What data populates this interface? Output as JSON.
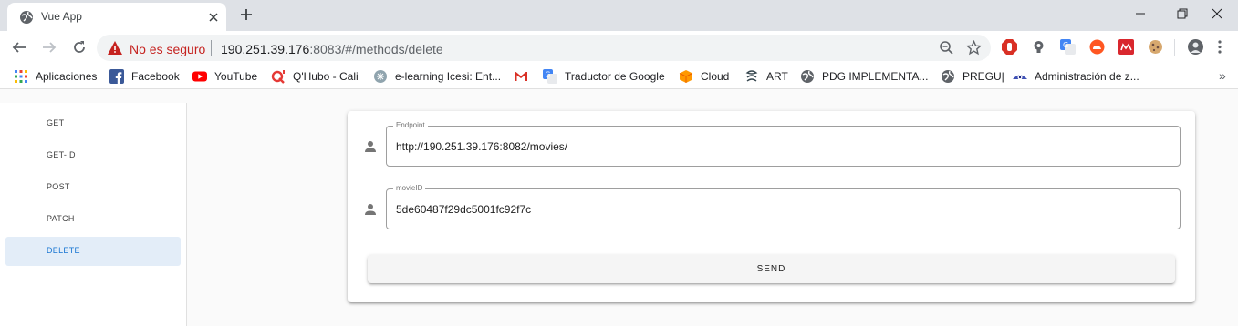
{
  "browser": {
    "tab": {
      "title": "Vue App"
    },
    "omnibox": {
      "security_label": "No es seguro",
      "url_host": "190.251.39.176",
      "url_rest": ":8083/#/methods/delete"
    },
    "bookmarks": [
      {
        "label": "Aplicaciones",
        "icon": "apps-grid-icon"
      },
      {
        "label": "Facebook",
        "icon": "facebook-icon"
      },
      {
        "label": "YouTube",
        "icon": "youtube-icon"
      },
      {
        "label": "Q'Hubo - Cali",
        "icon": "qhubo-icon"
      },
      {
        "label": "e-learning Icesi: Ent...",
        "icon": "elearning-icon"
      },
      {
        "label": "",
        "icon": "gmail-icon"
      },
      {
        "label": "Traductor de Google",
        "icon": "google-translate-icon"
      },
      {
        "label": "Cloud",
        "icon": "cloud-icon"
      },
      {
        "label": "ART",
        "icon": "art-icon"
      },
      {
        "label": "PDG IMPLEMENTA...",
        "icon": "globe-icon"
      },
      {
        "label": "PREGU|",
        "icon": "globe-icon"
      },
      {
        "label": "Administración de z...",
        "icon": "admin-icon"
      }
    ],
    "bookmarks_more": "»"
  },
  "sidebar": {
    "items": [
      {
        "label": "GET"
      },
      {
        "label": "GET-ID"
      },
      {
        "label": "POST"
      },
      {
        "label": "PATCH"
      },
      {
        "label": "DELETE",
        "active": true
      }
    ]
  },
  "form": {
    "endpoint": {
      "label": "Endpoint",
      "value": "http://190.251.39.176:8082/movies/"
    },
    "movie_id": {
      "label": "movieID",
      "value": "5de60487f29dc5001fc92f7c"
    },
    "send_label": "SEND"
  },
  "colors": {
    "accent": "#1976d2",
    "active_item_bg": "#e3edf8",
    "not_secure": "#c5221f"
  }
}
